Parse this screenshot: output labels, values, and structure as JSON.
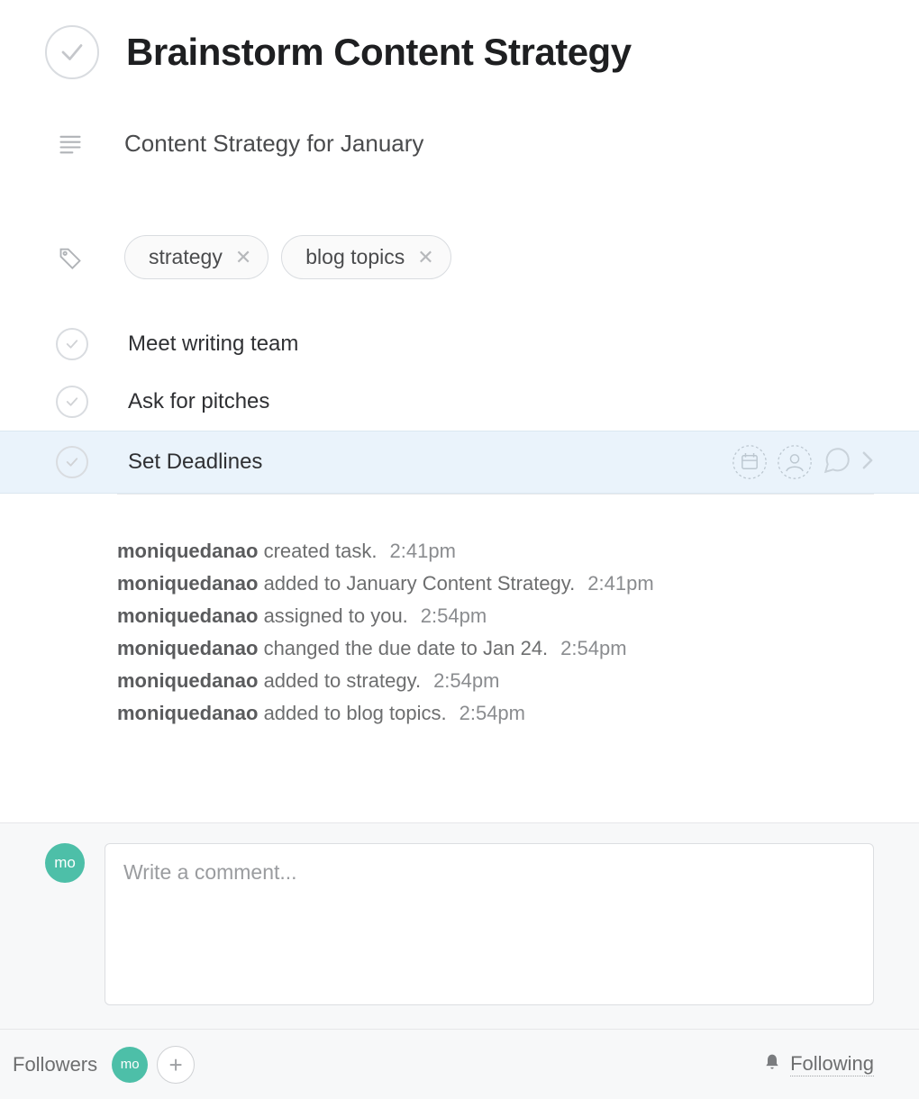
{
  "title": "Brainstorm Content Strategy",
  "project": "Content Strategy for January",
  "tags": [
    {
      "label": "strategy"
    },
    {
      "label": "blog topics"
    }
  ],
  "subtasks": [
    {
      "label": "Meet writing team",
      "selected": false
    },
    {
      "label": "Ask for pitches",
      "selected": false
    },
    {
      "label": "Set Deadlines",
      "selected": true
    }
  ],
  "activity": [
    {
      "user": "moniquedanao",
      "text": "created task.",
      "time": "2:41pm"
    },
    {
      "user": "moniquedanao",
      "text": "added to January Content Strategy.",
      "time": "2:41pm"
    },
    {
      "user": "moniquedanao",
      "text": "assigned to you.",
      "time": "2:54pm"
    },
    {
      "user": "moniquedanao",
      "text": "changed the due date to Jan 24.",
      "time": "2:54pm"
    },
    {
      "user": "moniquedanao",
      "text": "added to strategy.",
      "time": "2:54pm"
    },
    {
      "user": "moniquedanao",
      "text": "added to blog topics.",
      "time": "2:54pm"
    }
  ],
  "comment": {
    "placeholder": "Write a comment...",
    "avatar_initials": "mo"
  },
  "footer": {
    "followers_label": "Followers",
    "avatar_initials": "mo",
    "following_label": "Following"
  }
}
